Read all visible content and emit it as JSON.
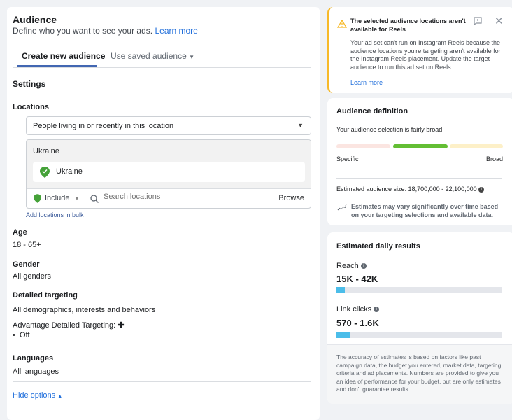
{
  "audience": {
    "title": "Audience",
    "subtitle": "Define who you want to see your ads.",
    "learn_more": "Learn more",
    "tabs": [
      {
        "label": "Create new audience",
        "active": true
      },
      {
        "label": "Use saved audience",
        "active": false
      }
    ],
    "settings_heading": "Settings",
    "locations": {
      "label": "Locations",
      "type_select": "People living in or recently in this location",
      "group_label": "Ukraine",
      "selected": [
        "Ukraine"
      ],
      "include_label": "Include",
      "search_placeholder": "Search locations",
      "browse": "Browse",
      "bulk_link": "Add locations in bulk"
    },
    "age": {
      "label": "Age",
      "value": "18 - 65+"
    },
    "gender": {
      "label": "Gender",
      "value": "All genders"
    },
    "detailed": {
      "label": "Detailed targeting",
      "value": "All demographics, interests and behaviors",
      "advantage_label": "Advantage Detailed Targeting:",
      "advantage_value": "Off"
    },
    "languages": {
      "label": "Languages",
      "value": "All languages"
    },
    "hide_options": "Hide options"
  },
  "warning": {
    "title": "The selected audience locations aren't available for Reels",
    "body": "Your ad set can't run on Instagram Reels because the audience locations you're targeting aren't available for the Instagram Reels placement. Update the target audience to run this ad set on Reels.",
    "learn_more": "Learn more",
    "accent": "#f7b928"
  },
  "definition": {
    "title": "Audience definition",
    "summary": "Your audience selection is fairly broad.",
    "level": "fairly broad",
    "specific": "Specific",
    "broad": "Broad",
    "size": "Estimated audience size: 18,700,000 - 22,100,000",
    "note": "Estimates may vary significantly over time based on your targeting selections and available data.",
    "colors": {
      "specific": "#fbe5e1",
      "middle": "#63be34",
      "broad": "#fdf0c8"
    }
  },
  "daily": {
    "title": "Estimated daily results",
    "reach": {
      "label": "Reach",
      "value": "15K - 42K",
      "percent": 5
    },
    "clicks": {
      "label": "Link clicks",
      "value": "570 - 1.6K",
      "percent": 8
    },
    "disclaimer": "The accuracy of estimates is based on factors like past campaign data, the budget you entered, market data, targeting criteria and ad placements. Numbers are provided to give you an idea of performance for your budget, but are only estimates and don't guarantee results."
  }
}
